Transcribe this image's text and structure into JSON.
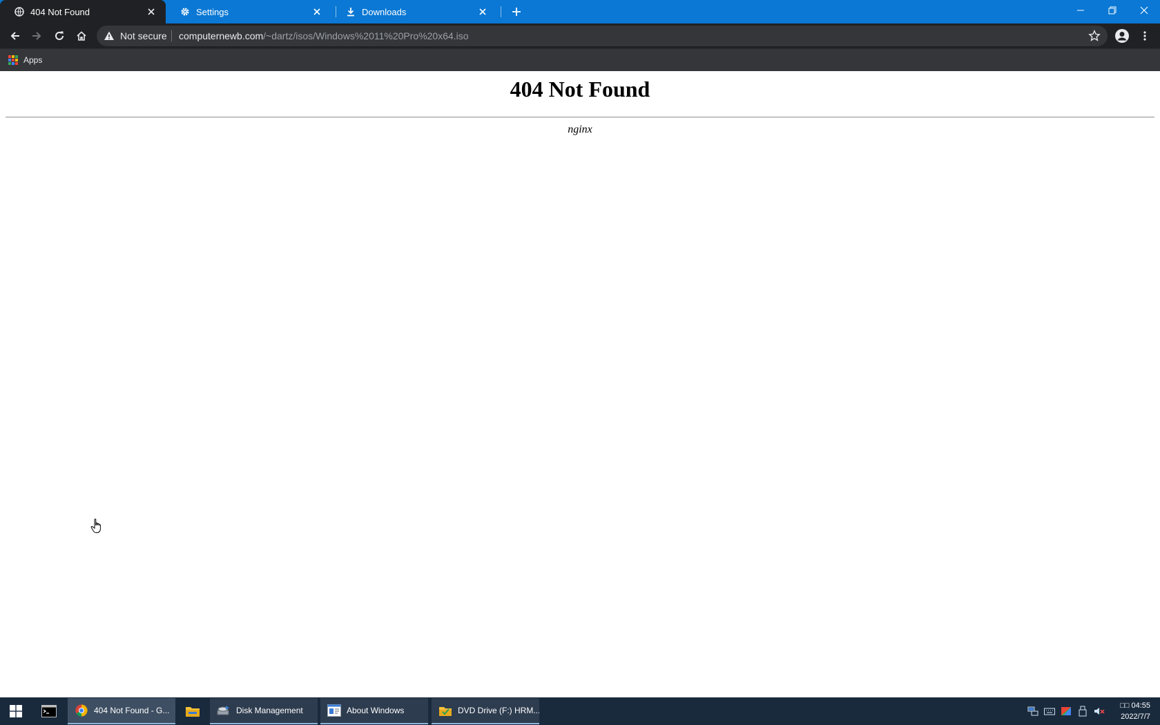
{
  "browser": {
    "tabs": [
      {
        "title": "404 Not Found",
        "icon": "globe-icon",
        "active": true
      },
      {
        "title": "Settings",
        "icon": "gear-icon",
        "active": false
      },
      {
        "title": "Downloads",
        "icon": "download-icon",
        "active": false
      }
    ],
    "omnibox": {
      "security_label": "Not secure",
      "url_host": "computernewb.com",
      "url_path": "/~dartz/isos/Windows%2011%20Pro%20x64.iso"
    },
    "bookmarks": {
      "apps_label": "Apps"
    }
  },
  "page": {
    "heading": "404 Not Found",
    "server": "nginx"
  },
  "taskbar": {
    "apps": [
      {
        "label": "404 Not Found - G...",
        "icon": "chrome-icon",
        "active": true
      },
      {
        "label": "Disk Management",
        "icon": "disk-management-icon",
        "active": false
      },
      {
        "label": "About Windows",
        "icon": "about-windows-icon",
        "active": false
      },
      {
        "label": "DVD Drive (F:) HRM...",
        "icon": "dvd-drive-icon",
        "active": false
      }
    ],
    "clock": {
      "time": "□□ 04:55",
      "date": "2022/7/7"
    }
  },
  "colors": {
    "tabstrip": "#0a78d4",
    "toolbar": "#202124",
    "omnibox": "#35363a",
    "taskbar": "#1a2a3d"
  }
}
